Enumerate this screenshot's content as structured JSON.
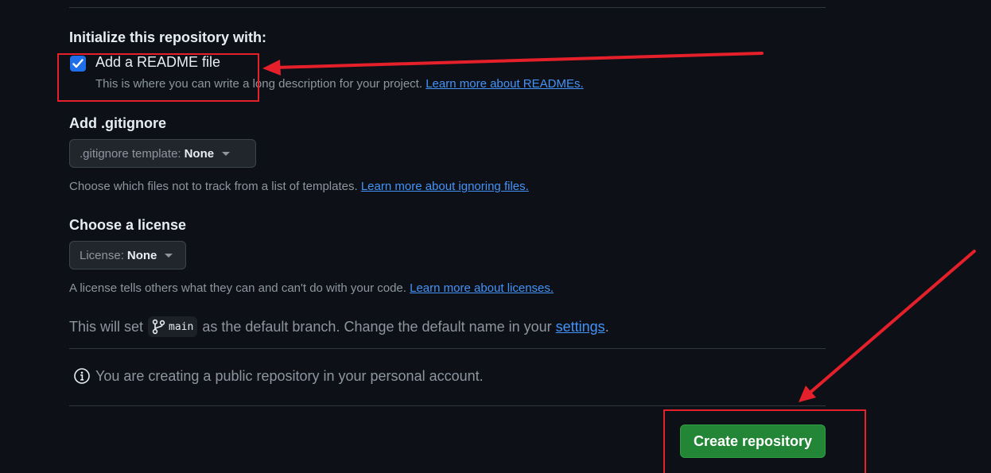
{
  "init": {
    "title": "Initialize this repository with:",
    "readme_label": "Add a README file",
    "readme_checked": true,
    "readme_desc": "This is where you can write a long description for your project.",
    "readme_link": "Learn more about READMEs."
  },
  "gitignore": {
    "title": "Add .gitignore",
    "select_label": ".gitignore template:",
    "select_value": "None",
    "desc": "Choose which files not to track from a list of templates.",
    "link": "Learn more about ignoring files."
  },
  "license": {
    "title": "Choose a license",
    "select_label": "License:",
    "select_value": "None",
    "desc": "A license tells others what they can and can't do with your code.",
    "link": "Learn more about licenses."
  },
  "branch": {
    "prefix": "This will set",
    "name": "main",
    "suffix": "as the default branch. Change the default name in your",
    "settings_link": "settings",
    "end": "."
  },
  "info": {
    "text": "You are creating a public repository in your personal account."
  },
  "actions": {
    "create_label": "Create repository"
  },
  "colors": {
    "accent": "#1f6feb",
    "link": "#4493f8",
    "create_button": "#238636",
    "annotation": "#e5202a"
  }
}
